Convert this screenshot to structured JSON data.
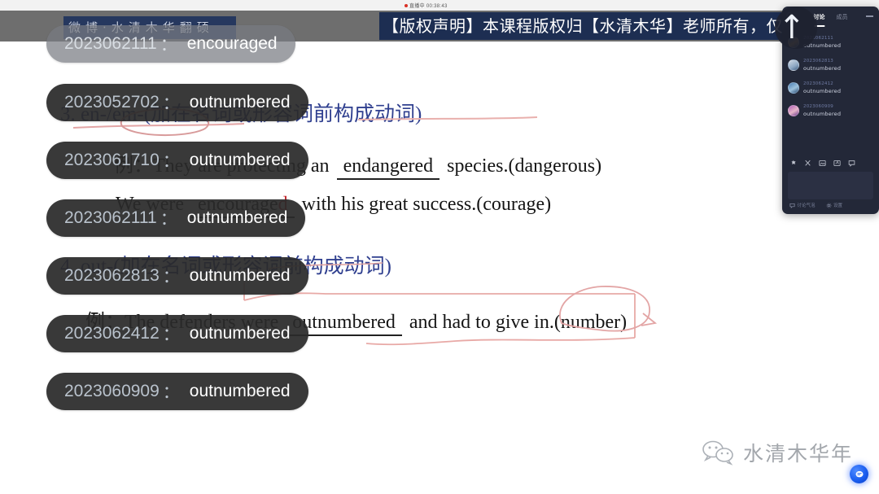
{
  "window": {
    "timer_text": "直播中 00:38:43"
  },
  "banner": {
    "copyright": "【版权声明】本课程版权归【水清木华】老师所有，仅限个"
  },
  "watermarks": {
    "weibo": "微博·水清木华翻硕",
    "wechat_name": "水清木华年"
  },
  "slide": {
    "heading_3": "3. en-/em-(加在名词或形容词前构成动词)",
    "example_1_prefix": "例：They are protecting an",
    "example_1_blank": "endangered",
    "example_1_suffix": "species.(dangerous)",
    "example_2_prefix": "We were",
    "example_2_blank_base": "encourage",
    "example_2_blank_red": "d",
    "example_2_suffix": "with his great success.(courage)",
    "heading_4": "4. out-(加在名词或形容词前构成动词)",
    "example_3_prefix": "例：The defenders were",
    "example_3_blank": "outnumbered",
    "example_3_suffix": "and had to give in.(number)"
  },
  "danmaku": [
    {
      "uid": "2023062111",
      "colon": "：",
      "msg": "encouraged",
      "faded": true
    },
    {
      "uid": "2023052702",
      "colon": "：",
      "msg": "outnumbered",
      "faded": false
    },
    {
      "uid": "2023061710",
      "colon": "：",
      "msg": "outnumbered",
      "faded": false
    },
    {
      "uid": "2023062111",
      "colon": "：",
      "msg": "outnumbered",
      "faded": false
    },
    {
      "uid": "2023062813",
      "colon": "：",
      "msg": "outnumbered",
      "faded": false
    },
    {
      "uid": "2023062412",
      "colon": "：",
      "msg": "outnumbered",
      "faded": false
    },
    {
      "uid": "2023060909",
      "colon": "：",
      "msg": "outnumbered",
      "faded": false
    }
  ],
  "chat_panel": {
    "tabs": [
      {
        "label": "讨论",
        "active": true
      },
      {
        "label": "成员",
        "active": false
      }
    ],
    "messages": [
      {
        "uid": "2023062111",
        "msg": "outnumbered"
      },
      {
        "uid": "2023062813",
        "msg": "outnumbered"
      },
      {
        "uid": "2023062412",
        "msg": "outnumbered"
      },
      {
        "uid": "2023060909",
        "msg": "outnumbered"
      }
    ],
    "footer": {
      "bubble_toggle": "讨论气泡",
      "settings": "设置"
    }
  },
  "colors": {
    "banner_navy": "#1d2e52",
    "gray_bar": "#6e6e6e",
    "bubble_bg": "#2a2a2a",
    "heading_blue": "#2f3f8f",
    "ink_red": "#e2a0a0",
    "answer_red": "#c1272d",
    "panel_bg": "#232838"
  }
}
